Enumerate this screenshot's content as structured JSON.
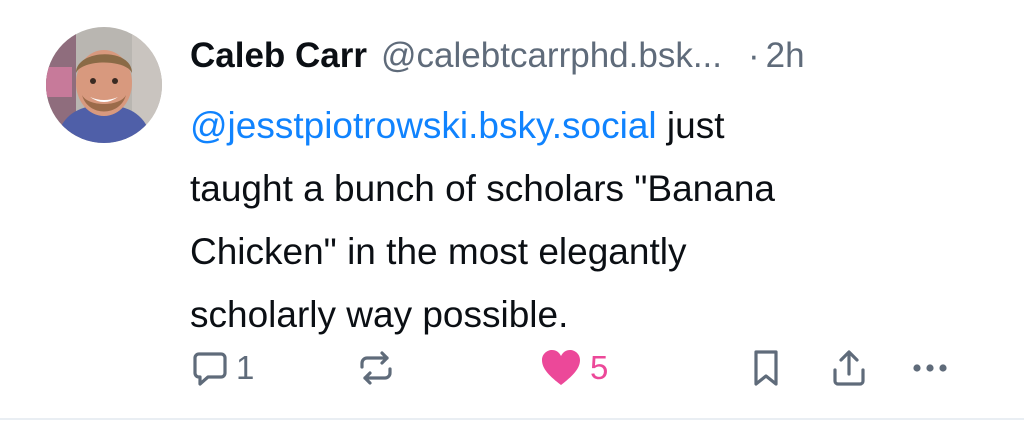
{
  "post": {
    "author": {
      "display_name": "Caleb Carr",
      "handle": "@calebtcarrphd.bsk...",
      "avatar_icon": "profile-photo"
    },
    "separator": "·",
    "timestamp": "2h",
    "text": {
      "mention": "@jesstpiotrowski.bsky.social",
      "line1_rest": " just",
      "line2": "taught a bunch of scholars \"Banana",
      "line3": "Chicken\" in the most elegantly",
      "line4": "scholarly way possible."
    },
    "actions": {
      "reply": {
        "icon": "reply-icon",
        "count": "1"
      },
      "repost": {
        "icon": "repost-icon",
        "count": ""
      },
      "like": {
        "icon": "heart-icon",
        "count": "5",
        "liked": true
      },
      "bookmark": {
        "icon": "bookmark-icon"
      },
      "share": {
        "icon": "share-icon"
      },
      "more": {
        "icon": "more-icon"
      }
    }
  },
  "colors": {
    "text": "#0b0f14",
    "secondary": "#5f6b7a",
    "link": "#1083fe",
    "like": "#ec4899",
    "divider": "#e9eef3"
  }
}
